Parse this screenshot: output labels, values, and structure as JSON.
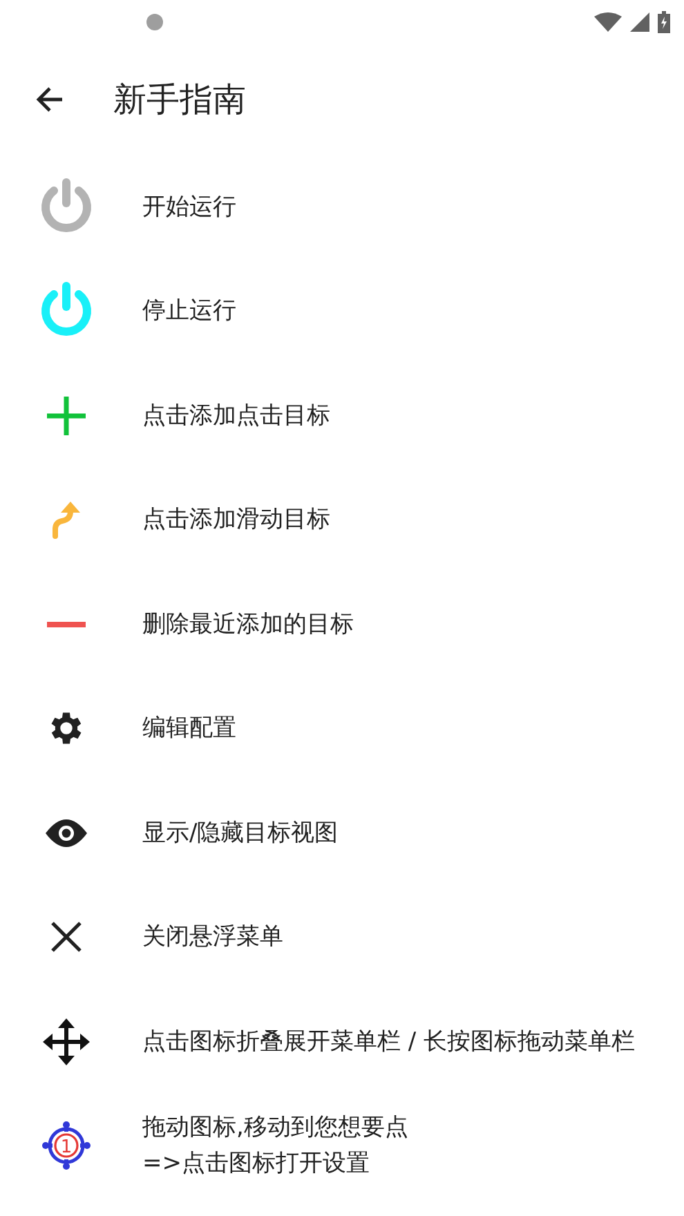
{
  "app_bar": {
    "title": "新手指南"
  },
  "items": [
    {
      "kind": "power",
      "color": "#b3b3b3",
      "lines": [
        "开始运行"
      ]
    },
    {
      "kind": "power",
      "color": "#19f0f8",
      "lines": [
        "停止运行"
      ]
    },
    {
      "kind": "plus",
      "lines": [
        "点击添加点击目标"
      ]
    },
    {
      "kind": "swipe",
      "lines": [
        "点击添加滑动目标"
      ]
    },
    {
      "kind": "minus",
      "lines": [
        "删除最近添加的目标"
      ]
    },
    {
      "kind": "gear",
      "lines": [
        "编辑配置"
      ]
    },
    {
      "kind": "eye",
      "lines": [
        "显示/隐藏目标视图"
      ]
    },
    {
      "kind": "close",
      "lines": [
        "关闭悬浮菜单"
      ]
    },
    {
      "kind": "move",
      "lines": [
        "点击图标折叠展开菜单栏 / 长按图标拖动菜单栏"
      ]
    },
    {
      "kind": "target",
      "badge": "1",
      "lines": [
        "拖动图标,移动到您想要点",
        "=>点击图标打开设置"
      ]
    }
  ]
}
